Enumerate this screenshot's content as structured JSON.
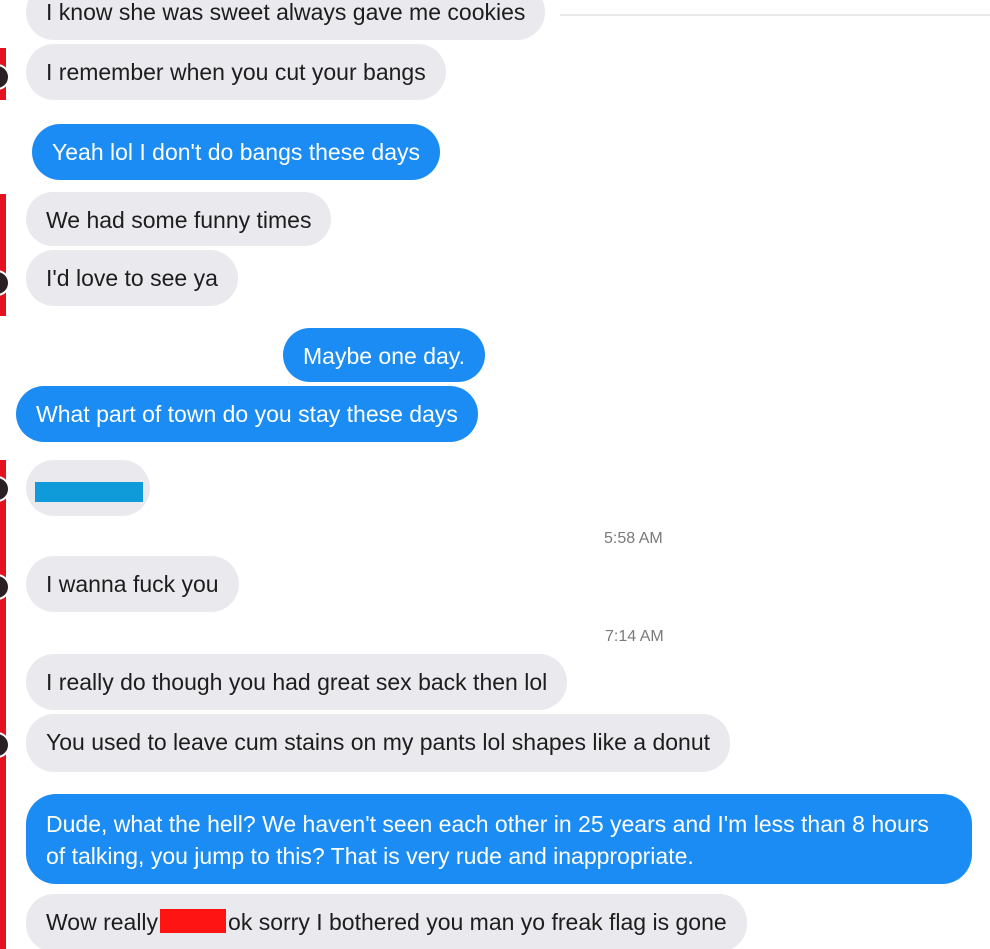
{
  "messages": {
    "m0": "I know she was sweet always gave me cookies",
    "m1": "I remember when you cut your bangs",
    "m2": "Yeah lol I don't do bangs these days",
    "m3": "We had some funny times",
    "m4": "I'd love to see ya",
    "m5": "Maybe one day.",
    "m6": "What part of town do you stay these days",
    "ts1": "5:58 AM",
    "m8": "I wanna fuck you",
    "ts2": "7:14 AM",
    "m9": "I really do though you had great sex back then lol",
    "m10": "You used to leave cum stains on my pants lol shapes like a donut",
    "m11": "Dude, what the hell? We haven't seen each other in 25 years and I'm less than 8 hours of talking, you jump to this? That is very rude and inappropriate.",
    "m12_before": "Wow really",
    "m12_after": "ok sorry I bothered you man yo freak flag is gone"
  },
  "colors": {
    "incoming_bubble": "#e9e9ee",
    "outgoing_bubble": "#1a8cf3",
    "redaction_blue": "#0f9ad9",
    "redaction_red": "#ff1414",
    "edge_marker": "#e4121f"
  }
}
